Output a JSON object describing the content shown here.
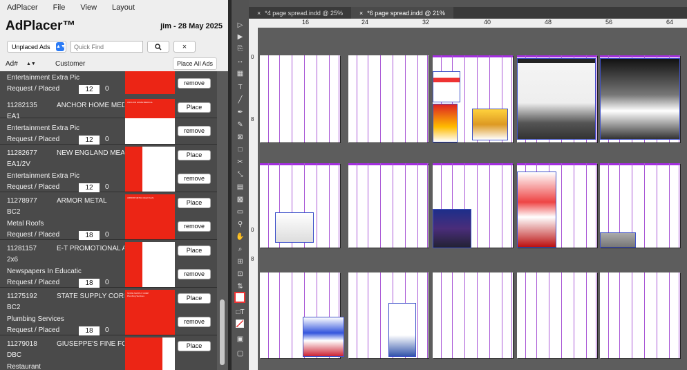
{
  "menu": {
    "app": "AdPlacer",
    "file": "File",
    "view": "View",
    "layout": "Layout"
  },
  "header": {
    "title": "AdPlacer™",
    "user_date": "jim - 28 May 2025"
  },
  "toolbar": {
    "filter_value": "Unplaced Ads",
    "search_placeholder": "Quick Find",
    "search_icon": "magnifier",
    "clear_icon": "×"
  },
  "columns": {
    "ad_num": "Ad#",
    "customer": "Customer",
    "place_all": "Place All Ads"
  },
  "rows": [
    {
      "id": "",
      "customer": "",
      "size": "",
      "section": "Entertainment Extra Pic",
      "status": "Request / Placed",
      "qty": "12",
      "placed": "0",
      "button": "remove",
      "show_place": false,
      "thumb_note": ""
    },
    {
      "id": "11282135",
      "customer": "ANCHOR HOME MEDICAL",
      "size": "EA1",
      "section": "Entertainment Extra Pic",
      "status": "Request / Placed",
      "qty": "12",
      "placed": "0",
      "place": "Place",
      "button": "remove",
      "thumb_note": "ANCHOR HOME MEDICAL"
    },
    {
      "id": "11282677",
      "customer": "NEW ENGLAND MEAT",
      "size": "EA1/2V",
      "section": "Entertainment Extra Pic",
      "status": "Request / Placed",
      "qty": "12",
      "placed": "0",
      "place": "Place",
      "button": "remove",
      "thumb_note": ""
    },
    {
      "id": "11278977",
      "customer": "ARMOR METAL",
      "size": "BC2",
      "section": "Metal Roofs",
      "status": "Request / Placed",
      "qty": "18",
      "placed": "0",
      "place": "Place",
      "button": "remove",
      "thumb_note": "ARMOR METAL Metal Roofs"
    },
    {
      "id": "11281157",
      "customer": "E-T PROMOTIONAL AN",
      "size": "2x6",
      "section": "Newspapers In Educatic",
      "status": "Request / Placed",
      "qty": "18",
      "placed": "0",
      "place": "Place",
      "button": "remove",
      "thumb_note": ""
    },
    {
      "id": "11275192",
      "customer": "STATE SUPPLY CORP",
      "size": "BC2",
      "section": "Plumbing Services",
      "status": "Request / Placed",
      "qty": "18",
      "placed": "0",
      "place": "Place",
      "button": "remove",
      "thumb_note": "STATE SUPPLY CORP Plumbing Services"
    },
    {
      "id": "11279018",
      "customer": "GIUSEPPE'S FINE FOOD",
      "size": "DBC",
      "section": "Restaurant",
      "status": "",
      "qty": "",
      "placed": "",
      "place": "Place",
      "button": "",
      "thumb_note": ""
    }
  ],
  "tabs": [
    {
      "label": "*4 page spread.indd @ 25%",
      "close": "×"
    },
    {
      "label": "*6 page spread.indd @ 21%",
      "close": "×"
    }
  ],
  "ruler": {
    "top": [
      "16",
      "24",
      "32",
      "40",
      "48",
      "56",
      "64"
    ],
    "left": [
      "0",
      "8",
      "0",
      "8"
    ]
  },
  "colors": {
    "ad_red": "#ec2515",
    "column_guide": "#a957d6",
    "ad_frame": "#3f52c9",
    "toggle": "#2b7bf5"
  }
}
